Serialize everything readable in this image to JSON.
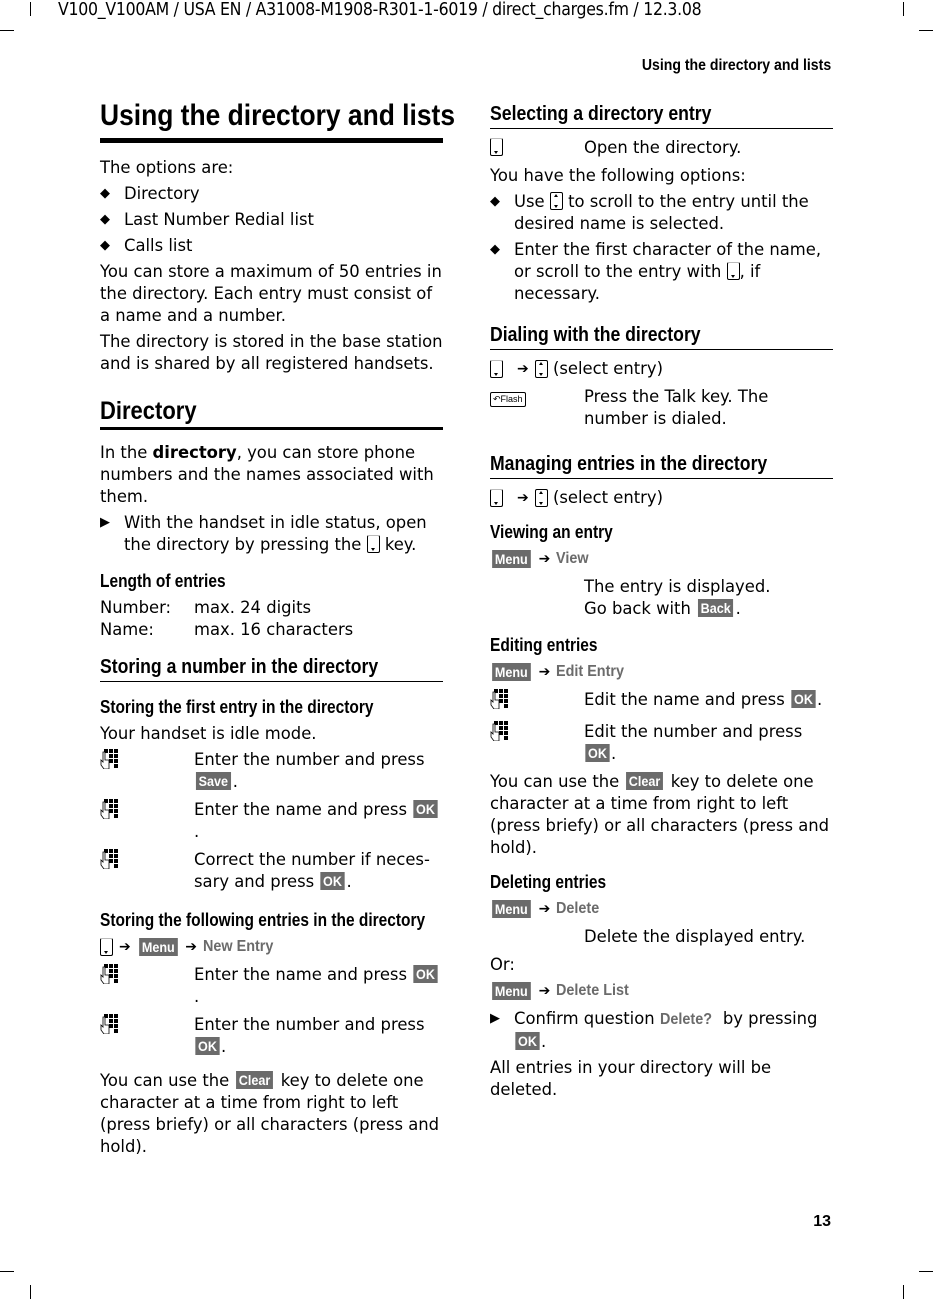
{
  "header_meta": "V100_V100AM / USA EN / A31008-M1908-R301-1-6019 / direct_charges.fm / 12.3.08",
  "running_head": "Using the directory and lists",
  "page_number": "13",
  "left": {
    "title": "Using the directory and lists",
    "intro": "The options are:",
    "options": [
      "Directory",
      "Last Number Redial list",
      "Calls list"
    ],
    "p1": "You can store a maximum of 50 entries in the directory. Each entry must consist of a name and a number.",
    "p2": "The directory is stored in the base station and is shared by all registered handsets.",
    "directory": {
      "heading": "Directory",
      "p_pre": "In the ",
      "p_bold": "directory",
      "p_post": ", you can store phone numbers and the names associated with them.",
      "action_pre": "With the handset in idle status, open the directory by pressing the",
      "action_post": "key.",
      "length_heading": "Length of entries",
      "lengths": [
        {
          "label": "Number:",
          "value": "max. 24 digits"
        },
        {
          "label": "Name:",
          "value": "max. 16 characters"
        }
      ]
    },
    "storing": {
      "heading": "Storing a number in the directory",
      "first_heading": "Storing the first entry in the directory",
      "first_intro": "Your handset is idle mode.",
      "first_steps": [
        {
          "text": "Enter the number and press",
          "key": "Save"
        },
        {
          "text": "Enter the name and press",
          "key": "OK"
        },
        {
          "text": "Correct the number if neces-sary and press",
          "key": "OK"
        }
      ],
      "following_heading": "Storing the following entries in the directory",
      "following_nav": {
        "menu": "Menu",
        "item": "New Entry"
      },
      "following_steps": [
        {
          "text": "Enter the name and press",
          "key": "OK"
        },
        {
          "text": "Enter the number and press",
          "key": "OK"
        }
      ],
      "clear_pre": "You can use the",
      "clear_key": "Clear",
      "clear_post": "key to delete one character at a time from right to left (press briefy) or all characters (press and hold)."
    }
  },
  "right": {
    "selecting": {
      "heading": "Selecting a directory entry",
      "step": "Open the directory.",
      "intro": "You have the following options:",
      "opt1_pre": "Use",
      "opt1_post": "to scroll to the entry until the desired name is selected.",
      "opt2_pre": "Enter the first character of the name, or scroll to the entry with",
      "opt2_post": ", if necessary."
    },
    "dialing": {
      "heading": "Dialing with the directory",
      "nav_suffix": "(select entry)",
      "flash_label": "Flash",
      "step": "Press the Talk key. The number is dialed."
    },
    "managing": {
      "heading": "Managing entries in the directory",
      "nav_suffix": "(select entry)",
      "viewing": {
        "heading": "Viewing an entry",
        "menu": "Menu",
        "item": "View",
        "line1": "The entry is displayed.",
        "line2_pre": "Go back with",
        "line2_key": "Back"
      },
      "editing": {
        "heading": "Editing entries",
        "menu": "Menu",
        "item": "Edit Entry",
        "steps": [
          {
            "text": "Edit the name and press",
            "key": "OK"
          },
          {
            "text": "Edit the number and press",
            "key": "OK"
          }
        ],
        "clear_pre": "You can use the",
        "clear_key": "Clear",
        "clear_post": "key to delete one character at a time from right to left (press briefy) or all characters (press and hold)."
      },
      "deleting": {
        "heading": "Deleting entries",
        "menu": "Menu",
        "item": "Delete",
        "step": "Delete the displayed entry.",
        "or": "Or:",
        "menu2": "Menu",
        "item2": "Delete List",
        "confirm_pre": "Confirm question",
        "confirm_item": "Delete?",
        "confirm_mid": "by pressing",
        "confirm_key": "OK",
        "final": "All entries in your directory will be deleted."
      }
    }
  }
}
